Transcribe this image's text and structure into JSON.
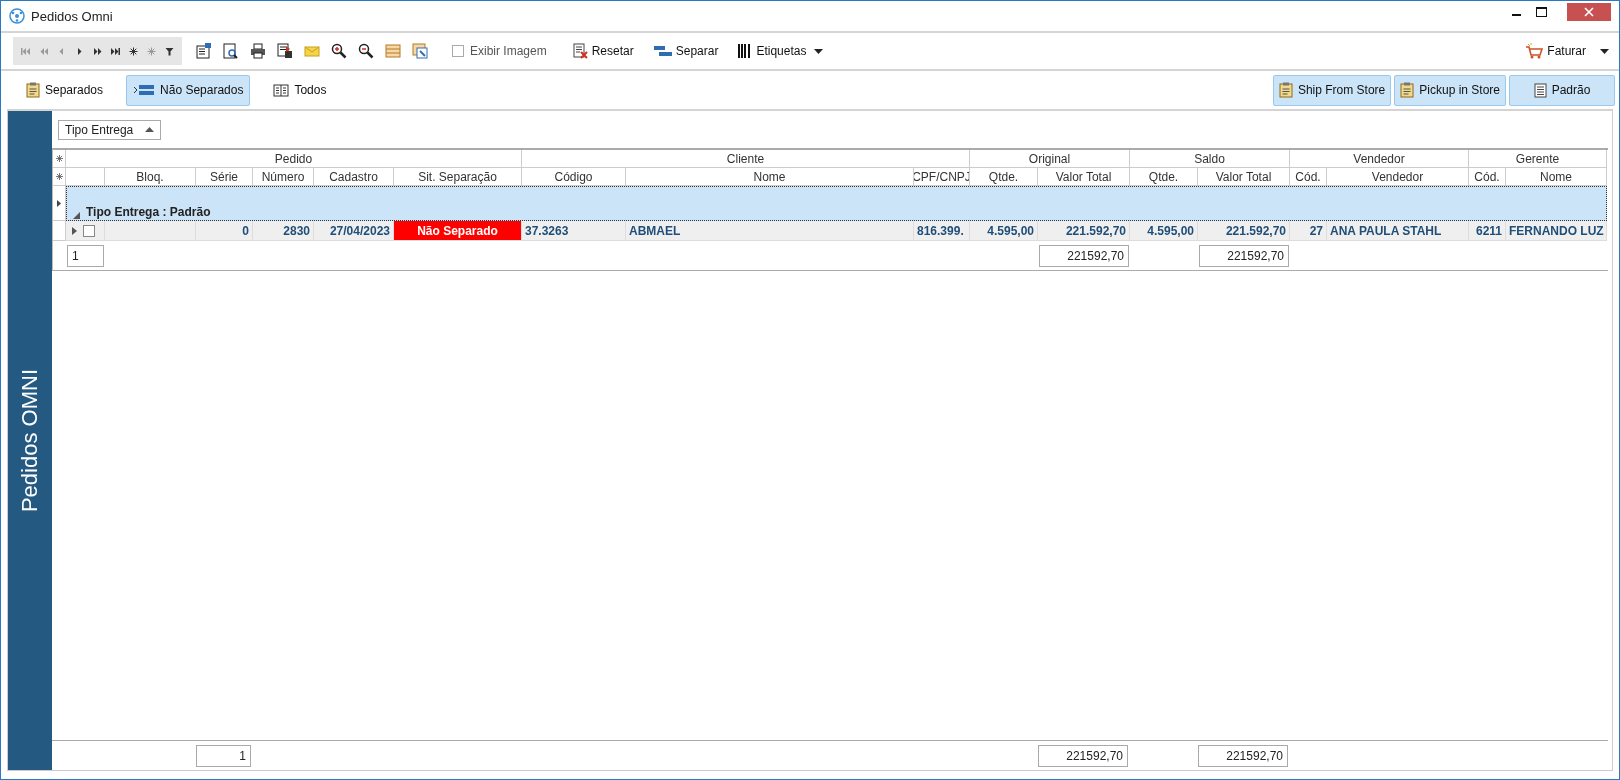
{
  "window": {
    "title": "Pedidos Omni"
  },
  "toolbar": {
    "show_image": {
      "label": "Exibir Imagem",
      "checked": false
    },
    "buttons": [
      {
        "label": "Resetar",
        "kind": "reset",
        "dropdown": false
      },
      {
        "label": "Separar",
        "kind": "separate",
        "dropdown": false
      },
      {
        "label": "Etiquetas",
        "kind": "barcode",
        "dropdown": true
      }
    ],
    "invoice": {
      "label": "Faturar",
      "dropdown": true
    }
  },
  "filters": [
    {
      "label": "Separados",
      "kind": "clipboard",
      "selected": false
    },
    {
      "label": "Não Separados",
      "kind": "bars",
      "selected": true
    },
    {
      "label": "Todos",
      "kind": "book",
      "selected": false
    }
  ],
  "delivery_filters": [
    {
      "label": "Ship From Store",
      "kind": "clipboard",
      "selected": true
    },
    {
      "label": "Pickup in Store",
      "kind": "clipboard",
      "selected": true
    },
    {
      "label": "Padrão",
      "kind": "list",
      "selected": true
    }
  ],
  "side_tab": {
    "label": "Pedidos OMNI"
  },
  "group_panel": {
    "label": "Tipo Entrega",
    "ascending": true
  },
  "grid": {
    "selector_column": true,
    "bands": [
      {
        "label": "Pedido",
        "columns": [
          {
            "label": "Bloq."
          },
          {
            "label": "Série"
          },
          {
            "label": "Número"
          },
          {
            "label": "Cadastro"
          },
          {
            "label": "Sit. Separação"
          }
        ]
      },
      {
        "label": "Cliente",
        "columns": [
          {
            "label": "Código"
          },
          {
            "label": "Nome"
          },
          {
            "label": "CPF/CNPJ"
          }
        ]
      },
      {
        "label": "Original",
        "columns": [
          {
            "label": "Qtde."
          },
          {
            "label": "Valor Total"
          }
        ]
      },
      {
        "label": "Saldo",
        "columns": [
          {
            "label": "Qtde."
          },
          {
            "label": "Valor Total"
          }
        ]
      },
      {
        "label": "Vendedor",
        "columns": [
          {
            "label": "Cód."
          },
          {
            "label": "Vendedor"
          }
        ]
      },
      {
        "label": "Gerente",
        "columns": [
          {
            "label": "Cód."
          },
          {
            "label": "Nome"
          }
        ]
      }
    ],
    "group": {
      "label": "Tipo Entrega : Padrão",
      "expanded": true
    },
    "rows": [
      {
        "cells": [
          {
            "kind": "selector",
            "expanded": false,
            "checked": false
          },
          {
            "kind": "empty"
          },
          {
            "kind": "number",
            "text": "0"
          },
          {
            "kind": "number",
            "text": "2830"
          },
          {
            "kind": "number",
            "text": "27/04/2023"
          },
          {
            "kind": "status",
            "text": "Não Separado",
            "color": "#ff0000"
          },
          {
            "kind": "text",
            "text": "37.3263"
          },
          {
            "kind": "text",
            "text": "ABMAEL"
          },
          {
            "kind": "text",
            "text": "816.399."
          },
          {
            "kind": "number",
            "text": "4.595,00"
          },
          {
            "kind": "number",
            "text": "221.592,70"
          },
          {
            "kind": "number",
            "text": "4.595,00"
          },
          {
            "kind": "number",
            "text": "221.592,70"
          },
          {
            "kind": "number",
            "text": "27"
          },
          {
            "kind": "text",
            "text": "ANA PAULA STAHL"
          },
          {
            "kind": "number",
            "text": "6211"
          },
          {
            "kind": "text",
            "text": "FERNANDO LUZ"
          }
        ]
      }
    ],
    "group_summary": [
      {
        "kind": "count",
        "text": "1"
      },
      {
        "kind": "empty"
      },
      {
        "kind": "empty"
      },
      {
        "kind": "empty"
      },
      {
        "kind": "empty"
      },
      {
        "kind": "empty"
      },
      {
        "kind": "empty"
      },
      {
        "kind": "empty"
      },
      {
        "kind": "empty"
      },
      {
        "kind": "empty"
      },
      {
        "kind": "total",
        "text": "221592,70"
      },
      {
        "kind": "empty"
      },
      {
        "kind": "total",
        "text": "221592,70"
      },
      {
        "kind": "empty"
      },
      {
        "kind": "empty"
      },
      {
        "kind": "empty"
      },
      {
        "kind": "empty"
      }
    ],
    "footer": [
      {
        "kind": "empty"
      },
      {
        "kind": "empty"
      },
      {
        "kind": "total",
        "text": "1"
      },
      {
        "kind": "empty"
      },
      {
        "kind": "empty"
      },
      {
        "kind": "empty"
      },
      {
        "kind": "empty"
      },
      {
        "kind": "empty"
      },
      {
        "kind": "empty"
      },
      {
        "kind": "empty"
      },
      {
        "kind": "total",
        "text": "221592,70"
      },
      {
        "kind": "empty"
      },
      {
        "kind": "total",
        "text": "221592,70"
      },
      {
        "kind": "empty"
      },
      {
        "kind": "empty"
      },
      {
        "kind": "empty"
      },
      {
        "kind": "empty"
      }
    ]
  }
}
